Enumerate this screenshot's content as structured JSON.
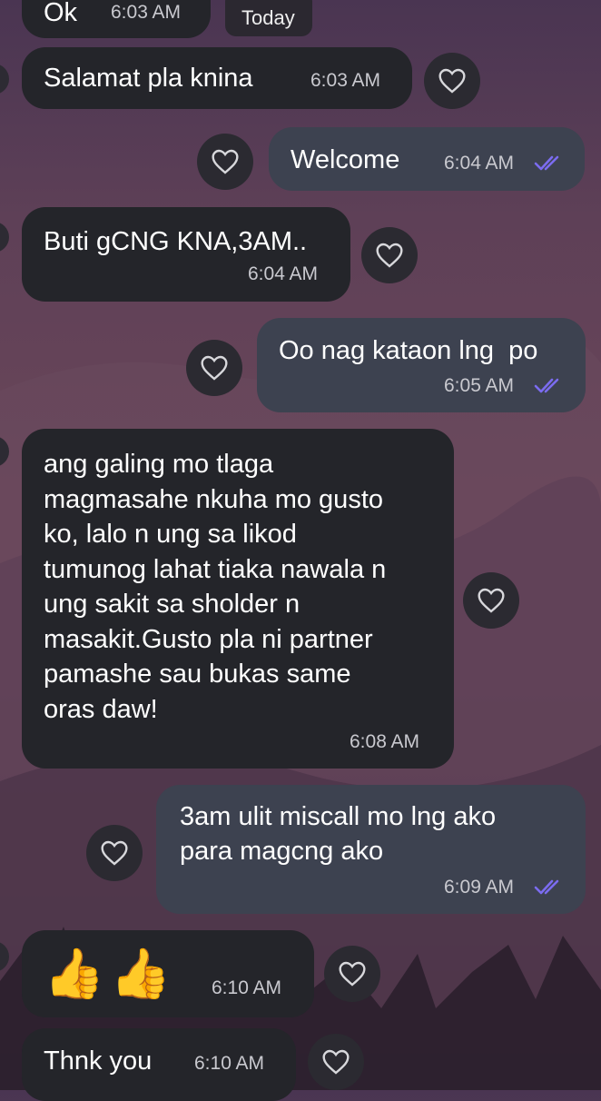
{
  "day_separator": "Today",
  "messages": [
    {
      "id": "m0",
      "direction": "in",
      "text": "Ok",
      "time": "6:03 AM"
    },
    {
      "id": "m1",
      "direction": "in",
      "text": "Salamat pla knina",
      "time": "6:03 AM"
    },
    {
      "id": "m2",
      "direction": "out",
      "text": "Welcome",
      "time": "6:04 AM",
      "status": "read"
    },
    {
      "id": "m3",
      "direction": "in",
      "text": "Buti gCNG KNA,3AM..",
      "time": "6:04 AM"
    },
    {
      "id": "m4",
      "direction": "out",
      "text": "Oo nag kataon lng  po",
      "time": "6:05 AM",
      "status": "read"
    },
    {
      "id": "m5",
      "direction": "in",
      "lines": [
        "ang galing mo tlaga",
        "magmasahe nkuha mo gusto",
        "ko, lalo n ung sa likod",
        "tumunog lahat tiaka nawala n",
        "ung sakit sa sholder n",
        "masakit.Gusto pla ni partner",
        "pamashe sau bukas same",
        "oras daw!"
      ],
      "time": "6:08 AM"
    },
    {
      "id": "m6",
      "direction": "out",
      "lines": [
        "3am ulit miscall mo lng ako",
        "para magcng ako"
      ],
      "time": "6:09 AM",
      "status": "read"
    },
    {
      "id": "m7",
      "direction": "in",
      "text": "👍👍",
      "time": "6:10 AM"
    },
    {
      "id": "m8",
      "direction": "in",
      "text": "Thnk you",
      "time": "6:10 AM"
    }
  ],
  "colors": {
    "incoming_bubble": "#24252a",
    "outgoing_bubble": "#3d4250",
    "read_ticks": "#7b6cf0"
  },
  "icons": {
    "reaction": "heart-outline-icon",
    "read_receipt": "double-check-icon"
  }
}
